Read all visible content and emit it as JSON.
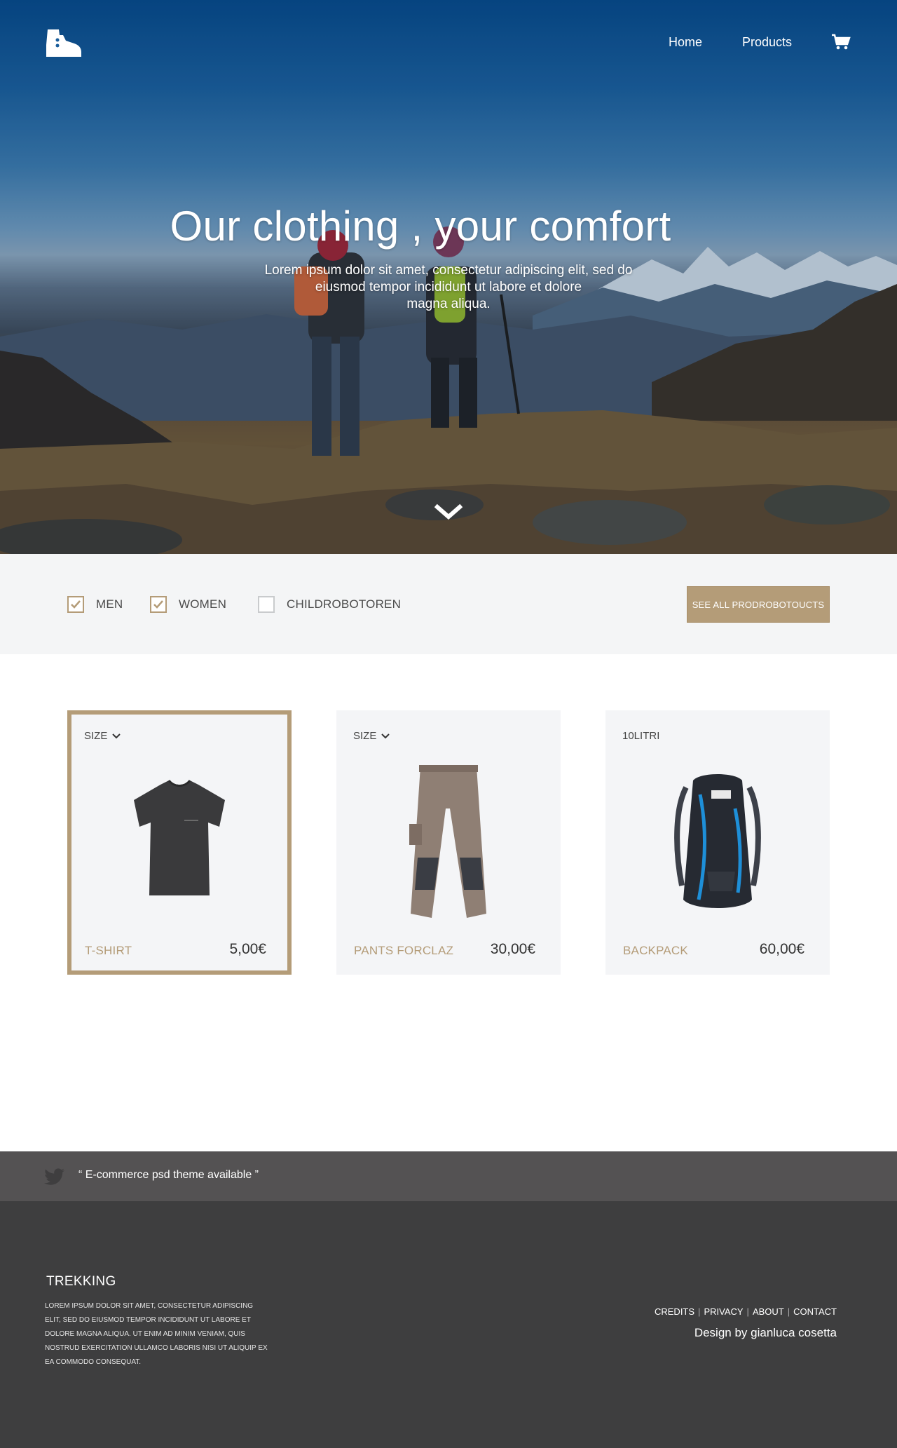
{
  "nav": {
    "logo_icon": "hiking-boot-icon",
    "home_label": "Home",
    "products_label": "Products",
    "cart_icon": "cart-icon"
  },
  "hero": {
    "title": "Our clothing , your comfort",
    "subtitle_line1": "Lorem ipsum dolor sit amet, consectetur adipiscing elit, sed do",
    "subtitle_line2": "eiusmod tempor incididunt ut labore et dolore",
    "subtitle_line3": "magna aliqua.",
    "scroll_icon": "chevron-down-icon"
  },
  "filters": {
    "items": [
      {
        "label": "MEN",
        "checked": true
      },
      {
        "label": "WOMEN",
        "checked": true
      },
      {
        "label": "CHILDROBOTOREN",
        "checked": false
      }
    ],
    "see_all_label": "SEE ALL PRODROBOTOUCTS"
  },
  "products": [
    {
      "top_label": "SIZE",
      "name": "T-SHIRT",
      "price": "5,00€",
      "selected": true,
      "image": "tshirt-image"
    },
    {
      "top_label": "SIZE",
      "name": "PANTS FORCLAZ",
      "price": "30,00€",
      "selected": false,
      "image": "pants-image"
    },
    {
      "top_label": "10LITRI",
      "name": "BACKPACK",
      "price": "60,00€",
      "selected": false,
      "image": "backpack-image"
    }
  ],
  "tweet": {
    "icon": "twitter-icon",
    "text": "“ E-commerce psd theme available ”"
  },
  "footer": {
    "brand": "TREKKING",
    "text": "Lorem ipsum dolor sit amet, consectetur adipiscing elit, sed do eiusmod tempor incididunt ut labore et dolore magna aliqua. Ut enim ad minim veniam, quis nostrud exercitation ullamco laboris nisi ut aliquip ex ea commodo consequat.",
    "links": [
      "CREDITS",
      "PRIVACY",
      "ABOUT",
      "CONTACT"
    ],
    "credit": "Design by gianluca cosetta"
  },
  "colors": {
    "accent": "#b49c78",
    "filter_bg": "#f4f5f6",
    "card_bg": "#f4f5f7",
    "tweet_bar": "#545253",
    "footer_bg": "#3e3e3f"
  }
}
